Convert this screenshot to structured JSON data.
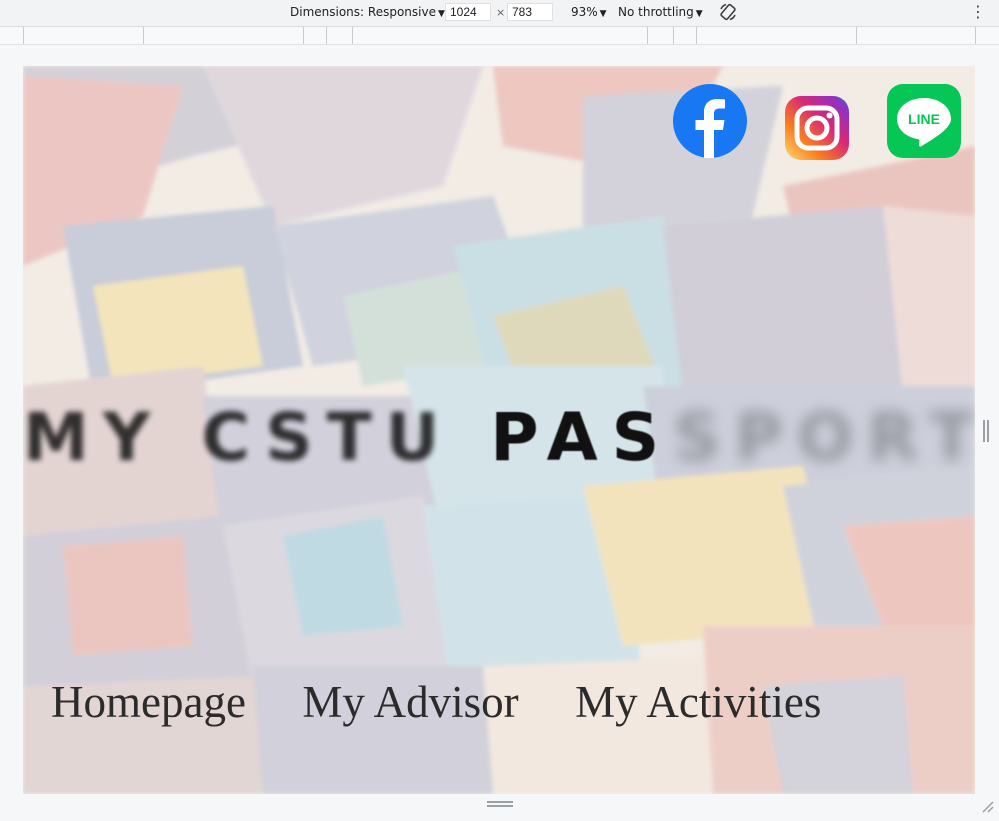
{
  "devtools": {
    "dimensions_label": "Dimensions: Responsive",
    "width_value": "1024",
    "times": "×",
    "height_value": "783",
    "zoom_label": "93%",
    "throttling_label": "No throttling",
    "more_icon": "⋮"
  },
  "site": {
    "title_parts": [
      "MY",
      "CSTU",
      "PAS",
      "SPORT"
    ],
    "social": [
      {
        "name": "facebook",
        "color": "#1877f2"
      },
      {
        "name": "instagram",
        "color": "#e1306c"
      },
      {
        "name": "line",
        "color": "#06c755",
        "label": "LINE"
      }
    ],
    "nav": [
      "Homepage",
      "My Advisor",
      "My Activities"
    ]
  }
}
